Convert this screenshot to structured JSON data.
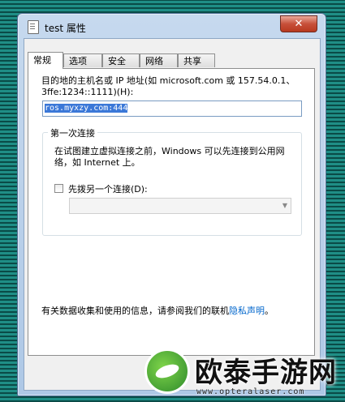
{
  "window": {
    "title": "test 属性",
    "close_symbol": "✕"
  },
  "tabs": [
    {
      "label": "常规",
      "active": true
    },
    {
      "label": "选项",
      "active": false
    },
    {
      "label": "安全",
      "active": false
    },
    {
      "label": "网络",
      "active": false
    },
    {
      "label": "共享",
      "active": false
    }
  ],
  "general": {
    "host_description": "目的地的主机名或 IP 地址(如 microsoft.com 或 157.54.0.1、3ffe:1234::1111)(H):",
    "host_value": "ros.myxzy.com:444",
    "first_connect": {
      "title": "第一次连接",
      "description": "在试图建立虚拟连接之前，Windows 可以先连接到公用网络，如 Internet 上。",
      "dial_first_label": "先拨另一个连接(D):",
      "dial_first_checked": false,
      "connection_select_value": ""
    },
    "privacy_text": "有关数据收集和使用的信息，请参阅我们的联机",
    "privacy_link": "隐私声明",
    "privacy_suffix": "。"
  },
  "watermark": {
    "brand": "欧泰手游网",
    "url": "www.opteralaser.com"
  },
  "colors": {
    "accent": "#3b78d8",
    "link": "#0066cc",
    "close": "#c7503a"
  }
}
